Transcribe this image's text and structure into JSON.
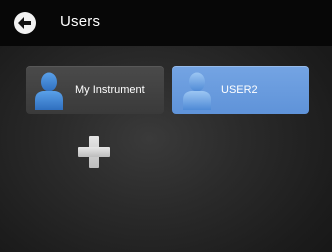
{
  "header": {
    "title": "Users",
    "back_icon": "back-arrow-icon"
  },
  "users": [
    {
      "label": "My Instrument",
      "avatar_icon": "user-avatar-icon",
      "selected": false
    },
    {
      "label": "USER2",
      "avatar_icon": "user-avatar-icon",
      "selected": true
    }
  ],
  "add_user": {
    "icon": "plus-icon"
  },
  "colors": {
    "header_bg": "#070707",
    "tile_bg": "#434343",
    "selected_tile_bg": "#6a9ddf",
    "avatar_blue": "#3d86d6",
    "text": "#ffffff"
  }
}
